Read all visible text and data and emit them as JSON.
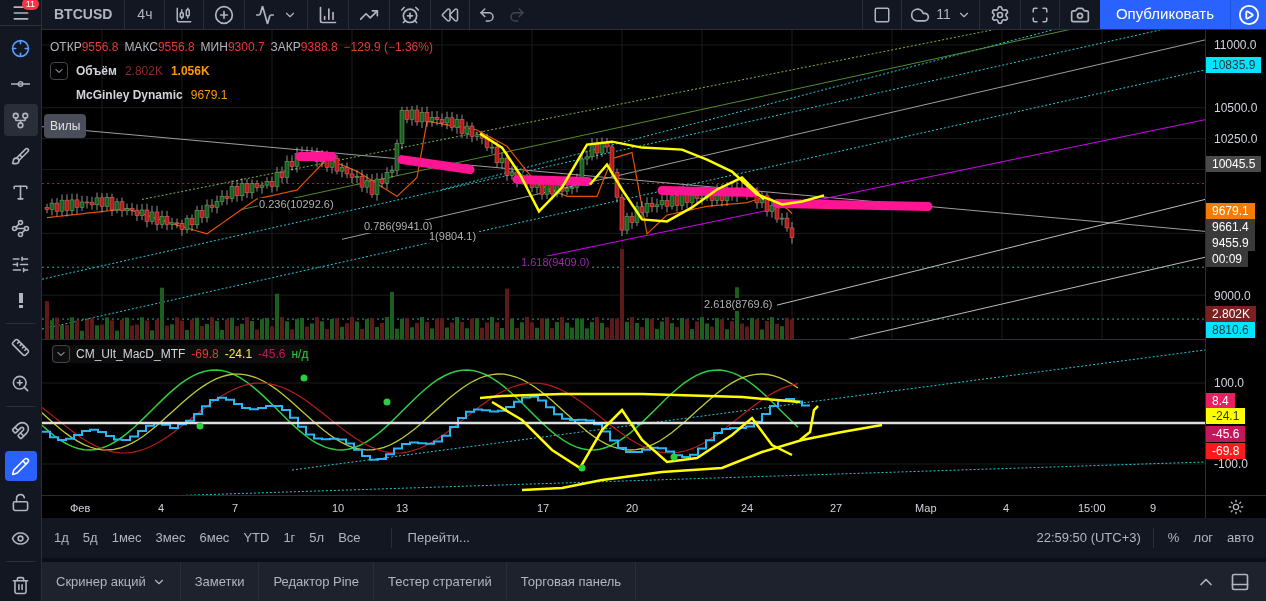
{
  "menu": {
    "badge": "11"
  },
  "top_bar": {
    "symbol": "BTCUSD",
    "interval": "4ч",
    "history": [
      {
        "kind": "undo",
        "disabled": false
      },
      {
        "kind": "redo",
        "disabled": true
      }
    ],
    "layout_count": "11",
    "publish_button": "Опубликовать"
  },
  "tools": [
    {
      "kind": "crosshair",
      "selected": true,
      "highlighted": false,
      "on": false
    },
    {
      "kind": "line",
      "selected": false,
      "highlighted": false,
      "on": false
    },
    {
      "kind": "pitchfork",
      "selected": false,
      "highlighted": true,
      "on": false
    },
    {
      "kind": "brush",
      "selected": false,
      "highlighted": false,
      "on": false
    },
    {
      "kind": "text",
      "selected": false,
      "highlighted": false,
      "on": false
    },
    {
      "kind": "pattern",
      "selected": false,
      "highlighted": false,
      "on": false
    },
    {
      "kind": "prediction",
      "selected": false,
      "highlighted": false,
      "on": false
    },
    {
      "kind": "alert",
      "selected": false,
      "highlighted": false,
      "on": false
    },
    {
      "kind": "ruler",
      "selected": false,
      "highlighted": false,
      "on": false
    },
    {
      "kind": "zoom",
      "selected": false,
      "highlighted": false,
      "on": false
    },
    {
      "kind": "magnet",
      "selected": false,
      "highlighted": false,
      "on": false
    },
    {
      "kind": "draw-lock",
      "selected": false,
      "highlighted": false,
      "on": true
    },
    {
      "kind": "lock",
      "selected": false,
      "highlighted": false,
      "on": false
    },
    {
      "kind": "eye",
      "selected": false,
      "highlighted": false,
      "on": false
    },
    {
      "kind": "trash",
      "selected": false,
      "highlighted": false,
      "on": false
    }
  ],
  "tool_tooltip": "Вилы",
  "legend": {
    "ohlc": [
      {
        "label": "ОТКР",
        "value": "9556.8"
      },
      {
        "label": "МАКС",
        "value": "9556.8"
      },
      {
        "label": "МИН",
        "value": "9300.7"
      },
      {
        "label": "ЗАКР",
        "value": "9388.8"
      }
    ],
    "change": "−129.9 (−1.36%)",
    "volume": {
      "name": "Объём",
      "value": "2.802K",
      "average": "1.056K"
    },
    "mcginley": {
      "name": "McGinley Dynamic",
      "value": "9679.1"
    }
  },
  "fib_labels": [
    {
      "text": "0.236(10292.6)",
      "color": "#b0b0b0"
    },
    {
      "text": "0.786(9941.0)",
      "color": "#b0b0b0"
    },
    {
      "text": "1(9804.1)",
      "color": "#b0b0b0"
    },
    {
      "text": "1.618(9409.0)",
      "color": "#9c27b0"
    },
    {
      "text": "2.618(8769.6)",
      "color": "#b0b0b0"
    }
  ],
  "price_axis": [
    {
      "text": "11000.0",
      "kind": "tick"
    },
    {
      "text": "10835.9",
      "kind": "badge",
      "color": "#00e5ff"
    },
    {
      "text": "10500.0",
      "kind": "tick"
    },
    {
      "text": "10250.0",
      "kind": "tick"
    },
    {
      "text": "10045.5",
      "kind": "badge",
      "color": "#4a4a4a"
    },
    {
      "text": "9679.1",
      "kind": "badge",
      "color": "#f57c00"
    },
    {
      "text": "9661.4",
      "kind": "badge",
      "color": "#3a3a3a"
    },
    {
      "text": "9455.9",
      "kind": "badge",
      "color": "#3a3a3a"
    },
    {
      "text": "00:09",
      "kind": "badge",
      "color": "#3a3a3a"
    },
    {
      "text": "9000.0",
      "kind": "tick"
    },
    {
      "text": "2.802K",
      "kind": "badge",
      "color": "#7b2020"
    },
    {
      "text": "8810.6",
      "kind": "badge",
      "color": "#00e5ff"
    }
  ],
  "macd": {
    "name": "CM_Ult_MacD_MTF",
    "values": [
      {
        "text": "-69.8",
        "color": "#e53935"
      },
      {
        "text": "-24.1",
        "color": "#ffeb3b"
      },
      {
        "text": "-45.6",
        "color": "#c2185b"
      },
      {
        "text": "н/д",
        "color": "#2ecc40"
      }
    ],
    "axis": [
      {
        "text": "100.0",
        "kind": "tick"
      },
      {
        "text": "8.4",
        "kind": "badge",
        "color": "#e91e63"
      },
      {
        "text": "-24.1",
        "kind": "badge",
        "color": "#ffff00"
      },
      {
        "text": "-45.6",
        "kind": "badge",
        "color": "#c2185b"
      },
      {
        "text": "-69.8",
        "kind": "badge",
        "color": "#ff1a1a"
      },
      {
        "text": "-100.0",
        "kind": "tick"
      }
    ]
  },
  "time_axis": [
    "Фев",
    "4",
    "7",
    "10",
    "13",
    "17",
    "20",
    "24",
    "27",
    "Мар",
    "4",
    "15:00",
    "9"
  ],
  "range_buttons": [
    "1д",
    "5д",
    "1мес",
    "3мес",
    "6мес",
    "YTD",
    "1г",
    "5л",
    "Все"
  ],
  "goto": "Перейти...",
  "clock": "22:59:50 (UTC+3)",
  "scale_buttons": [
    "%",
    "лог",
    "авто"
  ],
  "bottom_tabs": [
    {
      "label": "Скринер акций",
      "dropdown": true
    },
    {
      "label": "Заметки",
      "dropdown": false
    },
    {
      "label": "Редактор Pine",
      "dropdown": false
    },
    {
      "label": "Тестер стратегий",
      "dropdown": false
    },
    {
      "label": "Торговая панель",
      "dropdown": false
    }
  ]
}
